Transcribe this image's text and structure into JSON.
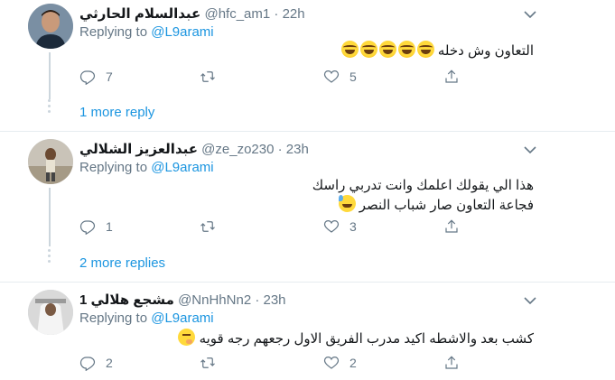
{
  "replies": [
    {
      "name": "عبدالسلام الحارثي",
      "handle": "@hfc_am1",
      "separator": "·",
      "time": "22h",
      "replying_prefix": "Replying to",
      "replying_to": "@L9arami",
      "text": "التعاون وش دخله",
      "emojis": [
        "laughing-emoji",
        "laughing-emoji",
        "laughing-emoji",
        "laughing-emoji",
        "laughing-emoji"
      ],
      "reply_count": "7",
      "retweet_count": "",
      "like_count": "5",
      "more_link": "1 more reply"
    },
    {
      "name": "عبدالعزيز الشلالي",
      "handle": "@ze_zo230",
      "separator": "·",
      "time": "23h",
      "replying_prefix": "Replying to",
      "replying_to": "@L9arami",
      "text_line1": "هذا الي يقولك اعلمك وانت تدربي راسك",
      "text_line2": "فجاعة التعاون صار شباب النصر",
      "emojis": [
        "sweat-smile-emoji"
      ],
      "reply_count": "1",
      "retweet_count": "",
      "like_count": "3",
      "more_link": "2 more replies"
    },
    {
      "name": "مشجع هلالي 1",
      "handle": "@NnHhNn2",
      "separator": "·",
      "time": "23h",
      "replying_prefix": "Replying to",
      "replying_to": "@L9arami",
      "text": "كشب بعد والاشطه اكيد مدرب الفريق الاول رجعهم رجه قويه",
      "emojis": [
        "thinking-emoji"
      ],
      "reply_count": "2",
      "retweet_count": "",
      "like_count": "2"
    }
  ],
  "icons": {
    "reply": "reply-icon",
    "retweet": "retweet-icon",
    "like": "heart-icon",
    "share": "share-icon",
    "more": "chevron-down-icon"
  },
  "colors": {
    "link": "#1b95e0",
    "secondary": "#657786",
    "border": "#e6ecf0"
  }
}
